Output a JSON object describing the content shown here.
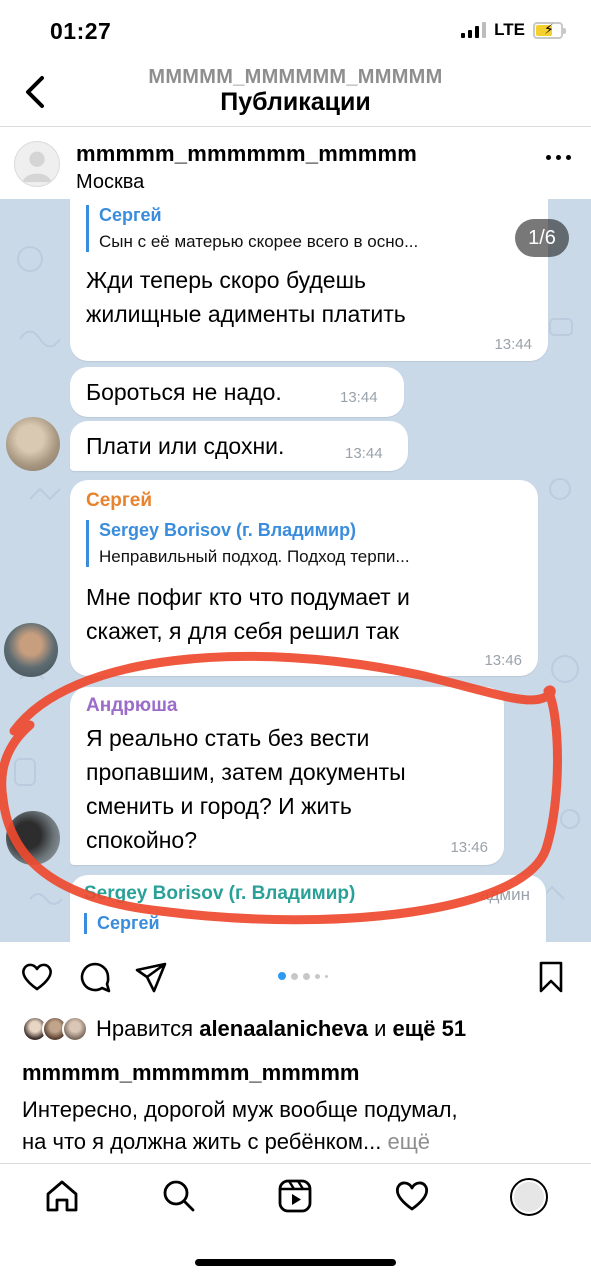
{
  "status": {
    "time": "01:27",
    "network": "LTE"
  },
  "header": {
    "account": "MMMMM_MMMMMM_MMMMM",
    "title": "Публикации"
  },
  "post": {
    "username": "mmmmm_mmmmmm_mmmmm",
    "location": "Москва",
    "counter": "1/6"
  },
  "chat": {
    "msg1": {
      "reply_name": "Сергей",
      "reply_text": "Сын с её матерью скорее всего в осно...",
      "text_line1": "Жди теперь скоро будешь",
      "text_line2": "жилищные адименты платить",
      "time": "13:44"
    },
    "msg2": {
      "text": "Бороться не надо.",
      "time": "13:44"
    },
    "msg3": {
      "text": "Плати или сдохни.",
      "time": "13:44"
    },
    "msg4": {
      "name": "Сергей",
      "reply_name": "Sergey Borisov (г. Владимир)",
      "reply_text": "Неправильный подход. Подход терпи...",
      "text_line1": "Мне пофиг кто что подумает и",
      "text_line2": "скажет, я для себя решил так",
      "time": "13:46"
    },
    "msg5": {
      "name": "Андрюша",
      "text_line1": "Я реально стать без вести",
      "text_line2": "пропавшим, затем документы",
      "text_line3": "сменить и город? И жить",
      "text_line4": "спокойно?",
      "time": "13:46"
    },
    "msg6": {
      "name": "Sergey Borisov (г. Владимир)",
      "role": "админ",
      "reply_name": "Сергей"
    },
    "colors": {
      "sergey": "#e8822d",
      "andryusha": "#9b6cc9",
      "borisov": "#2aa198",
      "reply": "#3a8ddc",
      "highlight": "#ee4a2f"
    }
  },
  "likes": {
    "prefix": "Нравится ",
    "user": "alenaalanicheva",
    "middle": " и ",
    "others": "ещё 51"
  },
  "caption": {
    "username": "mmmmm_mmmmmm_mmmmm",
    "line1": "Интересно, дорогой муж вообще подумал,",
    "line2": "на что я должна жить с ребёнком...",
    "more": " ещё"
  },
  "icons": {
    "back": "chevron-left-icon",
    "more": "more-horizontal-icon",
    "like": "heart-icon",
    "comment": "comment-icon",
    "share": "send-icon",
    "save": "bookmark-icon",
    "tabs": [
      "home-icon",
      "search-icon",
      "reels-icon",
      "activity-heart-icon",
      "profile-icon"
    ]
  }
}
